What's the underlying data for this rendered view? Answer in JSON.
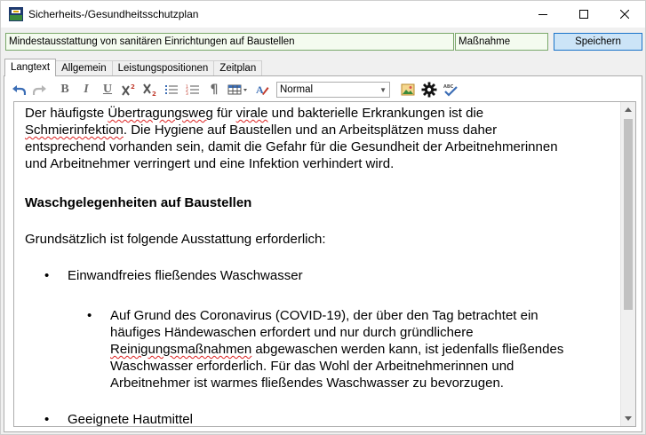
{
  "window": {
    "title": "Sicherheits-/Gesundheitsschutzplan"
  },
  "form": {
    "subject_value": "Mindestausstattung von sanitären Einrichtungen auf Baustellen",
    "type_value": "Maßnahme",
    "save_label": "Speichern"
  },
  "tabs": [
    {
      "label": "Langtext",
      "active": true
    },
    {
      "label": "Allgemein",
      "active": false
    },
    {
      "label": "Leistungspositionen",
      "active": false
    },
    {
      "label": "Zeitplan",
      "active": false
    }
  ],
  "toolbar": {
    "bold": "B",
    "italic": "I",
    "underline": "U",
    "paragraph": "¶",
    "style_value": "Normal"
  },
  "editor": {
    "intro_lines": [
      "Der häufigste ",
      "Übertragungsweg",
      " für ",
      "virale",
      " und bakterielle Erkrankungen ist die",
      "Schmierinfektion",
      ". Die Hygiene auf Baustellen und an Arbeitsplätzen muss daher",
      "entsprechend vorhanden sein, damit die Gefahr für die Gesundheit der Arbeitnehmerinnen",
      "und Arbeitnehmer verringert und eine Infektion verhindert wird."
    ],
    "heading": "Waschgelegenheiten auf Baustellen",
    "lead": "Grundsätzlich ist folgende Ausstattung erforderlich:",
    "bullet_1": "Einwandfreies fließendes Waschwasser",
    "sub_bullet_lines": [
      "Auf Grund des Coronavirus (COVID-19), der über den Tag betrachtet ein",
      "häufiges Händewaschen erfordert und nur durch gründlichere",
      "Reinigungsmaßnahmen",
      " abgewaschen werden kann, ist  jedenfalls fließendes",
      "Waschwasser erforderlich. Für das Wohl der Arbeitnehmerinnen und",
      "Arbeitnehmer  ist warmes fließendes Waschwasser zu bevorzugen."
    ],
    "bullet_2": "Geeignete Hautmittel",
    "bullet_char": "•"
  },
  "icons": {
    "app": "app-icon",
    "undo": "undo-icon",
    "redo": "redo-icon",
    "superscript": "superscript-icon",
    "subscript": "subscript-icon",
    "bullet_list": "bullet-list-icon",
    "numbered_list": "numbered-list-icon",
    "table": "table-icon",
    "text_color": "text-color-icon",
    "image": "image-icon",
    "settings": "gear-icon",
    "spellcheck": "spellcheck-icon"
  },
  "colors": {
    "input_border": "#7aa86a",
    "input_bg": "#f4fbef",
    "save_bg": "#cce4f7",
    "save_border": "#1a73c9",
    "spell_underline": "#dd2222"
  }
}
